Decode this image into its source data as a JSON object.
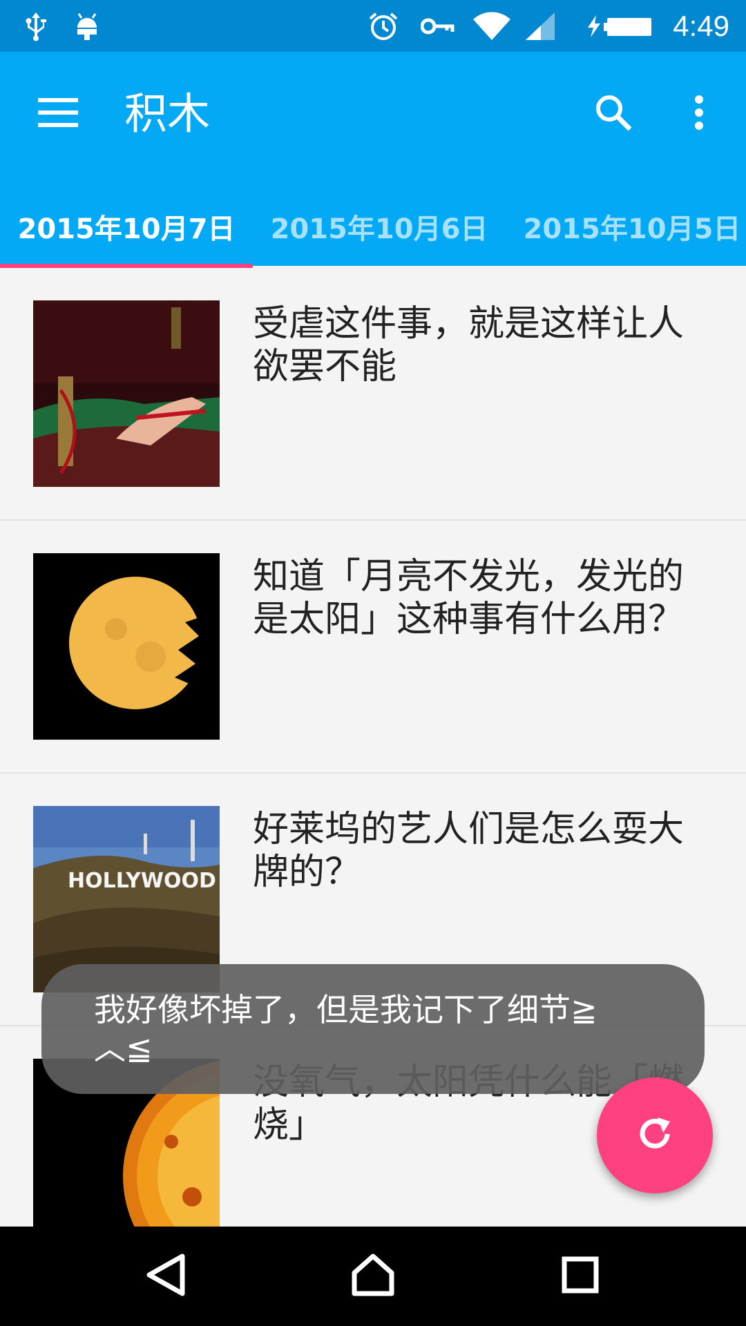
{
  "status_bar": {
    "icons": [
      "usb-icon",
      "android-debug-icon",
      "alarm-icon",
      "vpn-key-icon",
      "wifi-icon",
      "signal-icon",
      "battery-charging-icon"
    ],
    "time": "4:49"
  },
  "app_bar": {
    "title": "积木",
    "menu_icon": "menu-icon",
    "search_icon": "search-icon",
    "more_icon": "more-vert-icon",
    "background": "#03a9f4",
    "status_background": "#0288d1"
  },
  "tabs": [
    {
      "label": "2015年10月7日",
      "active": true
    },
    {
      "label": "2015年10月6日",
      "active": false
    },
    {
      "label": "2015年10月5日",
      "active": false
    }
  ],
  "accent": "#ff4081",
  "list": {
    "items": [
      {
        "title": "受虐这件事，就是这样让人欲罢不能"
      },
      {
        "title": "知道「月亮不发光，发光的是太阳」这种事有什么用？"
      },
      {
        "title": "好莱坞的艺人们是怎么耍大牌的？"
      },
      {
        "title": "没氧气，太阳凭什么能「燃烧」"
      }
    ]
  },
  "toast": {
    "text": "我好像坏掉了，但是我记下了细节≧︿≦"
  },
  "fab": {
    "icon": "refresh-icon"
  },
  "nav_bar": {
    "icons": [
      "back-icon",
      "home-icon",
      "recents-icon"
    ]
  }
}
